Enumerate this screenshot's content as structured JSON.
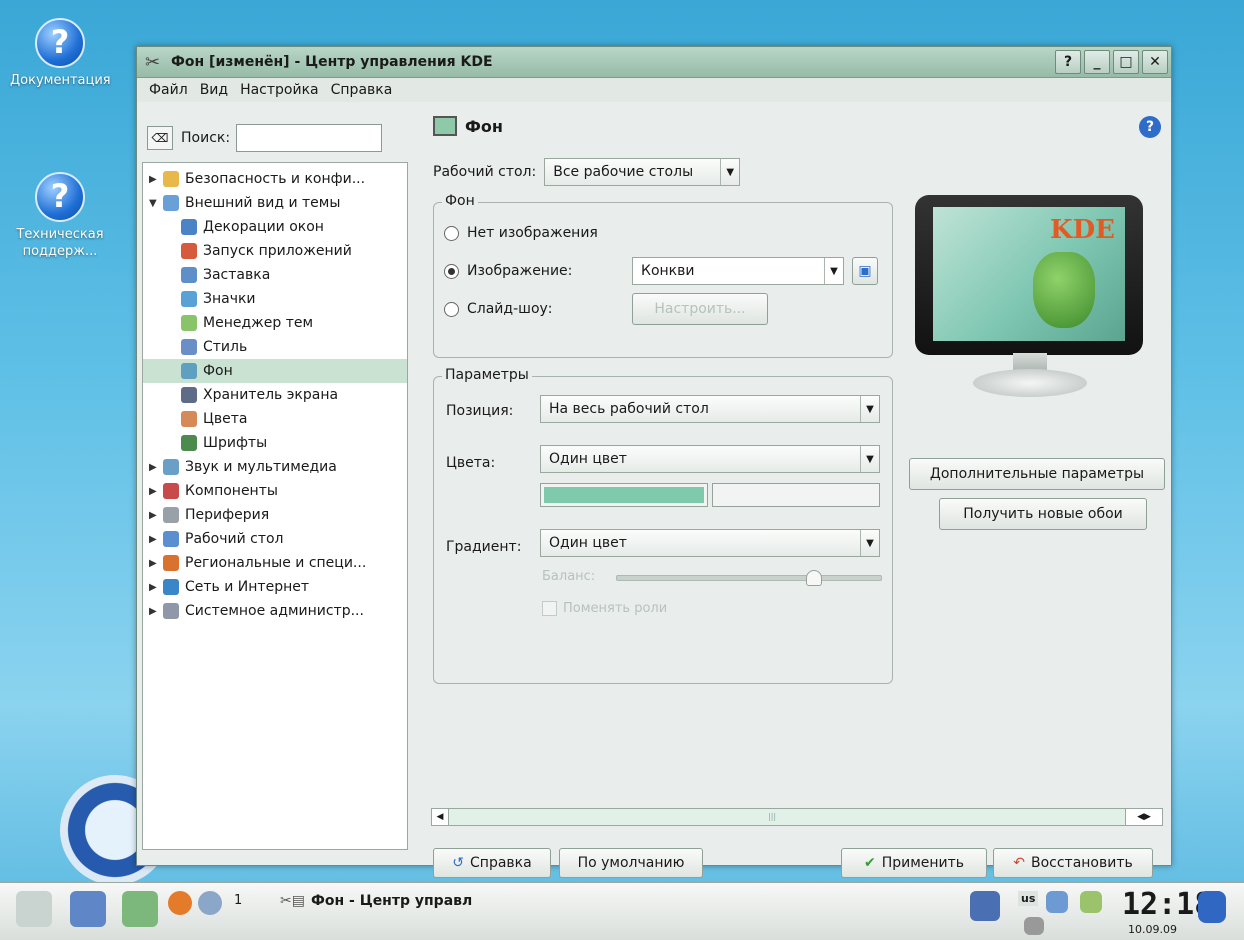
{
  "desktop": {
    "icons": [
      {
        "label": "Документация",
        "icon": "help-icon"
      },
      {
        "label": "Техническая поддерж...",
        "icon": "help-icon"
      }
    ]
  },
  "window": {
    "title": "Фон [изменён] - Центр управления KDE",
    "controls": [
      "?",
      "_",
      "□",
      "✕"
    ],
    "menu": [
      "Файл",
      "Вид",
      "Настройка",
      "Справка"
    ]
  },
  "sidebar": {
    "search_label": "Поиск:",
    "search_value": "",
    "items": [
      {
        "label": "Безопасность и конфи...",
        "level": 0,
        "expanded": false,
        "icon": "key-icon"
      },
      {
        "label": "Внешний вид и темы",
        "level": 0,
        "expanded": true,
        "icon": "appearance-icon"
      },
      {
        "label": "Декорации окон",
        "level": 1,
        "icon": "window-icon"
      },
      {
        "label": "Запуск приложений",
        "level": 1,
        "icon": "rocket-icon"
      },
      {
        "label": "Заставка",
        "level": 1,
        "icon": "splash-icon"
      },
      {
        "label": "Значки",
        "level": 1,
        "icon": "icons-icon"
      },
      {
        "label": "Менеджер тем",
        "level": 1,
        "icon": "theme-icon"
      },
      {
        "label": "Стиль",
        "level": 1,
        "icon": "style-icon"
      },
      {
        "label": "Фон",
        "level": 1,
        "selected": true,
        "icon": "background-icon"
      },
      {
        "label": "Хранитель экрана",
        "level": 1,
        "icon": "screensaver-icon"
      },
      {
        "label": "Цвета",
        "level": 1,
        "icon": "colors-icon"
      },
      {
        "label": "Шрифты",
        "level": 1,
        "icon": "fonts-icon"
      },
      {
        "label": "Звук и мультимедиа",
        "level": 0,
        "icon": "sound-icon"
      },
      {
        "label": "Компоненты",
        "level": 0,
        "icon": "components-icon"
      },
      {
        "label": "Периферия",
        "level": 0,
        "icon": "peripherals-icon"
      },
      {
        "label": "Рабочий стол",
        "level": 0,
        "icon": "desktop-icon"
      },
      {
        "label": "Региональные и специ...",
        "level": 0,
        "icon": "regional-icon"
      },
      {
        "label": "Сеть и Интернет",
        "level": 0,
        "icon": "network-icon"
      },
      {
        "label": "Системное администр...",
        "level": 0,
        "icon": "sysadmin-icon"
      }
    ]
  },
  "main": {
    "header": "Фон",
    "desktop_label": "Рабочий стол:",
    "desktop_value": "Все рабочие столы",
    "bg_group": "Фон",
    "radio_none": "Нет изображения",
    "radio_image": "Изображение:",
    "radio_slideshow": "Слайд-шоу:",
    "image_value": "Конкви",
    "configure_btn": "Настроить...",
    "params_group": "Параметры",
    "position_label": "Позиция:",
    "position_value": "На весь рабочий стол",
    "colors_label": "Цвета:",
    "colors_value": "Один цвет",
    "color1": "#7fc9ad",
    "color2": "#f2f4f3",
    "gradient_label": "Градиент:",
    "gradient_value": "Один цвет",
    "balance_label": "Баланс:",
    "balance_value": 0.75,
    "swap_label": "Поменять роли",
    "preview_logo": "KDE",
    "advanced_btn": "Дополнительные параметры",
    "get_new_btn": "Получить новые обои"
  },
  "buttons": {
    "help": "Справка",
    "defaults": "По умолчанию",
    "apply": "Применить",
    "reset": "Восстановить"
  },
  "taskbar": {
    "desktop_number": "1",
    "task_label": "Фон - Центр управл",
    "keyboard_layout": "us",
    "time": "12:18",
    "date": "10.09.09"
  }
}
